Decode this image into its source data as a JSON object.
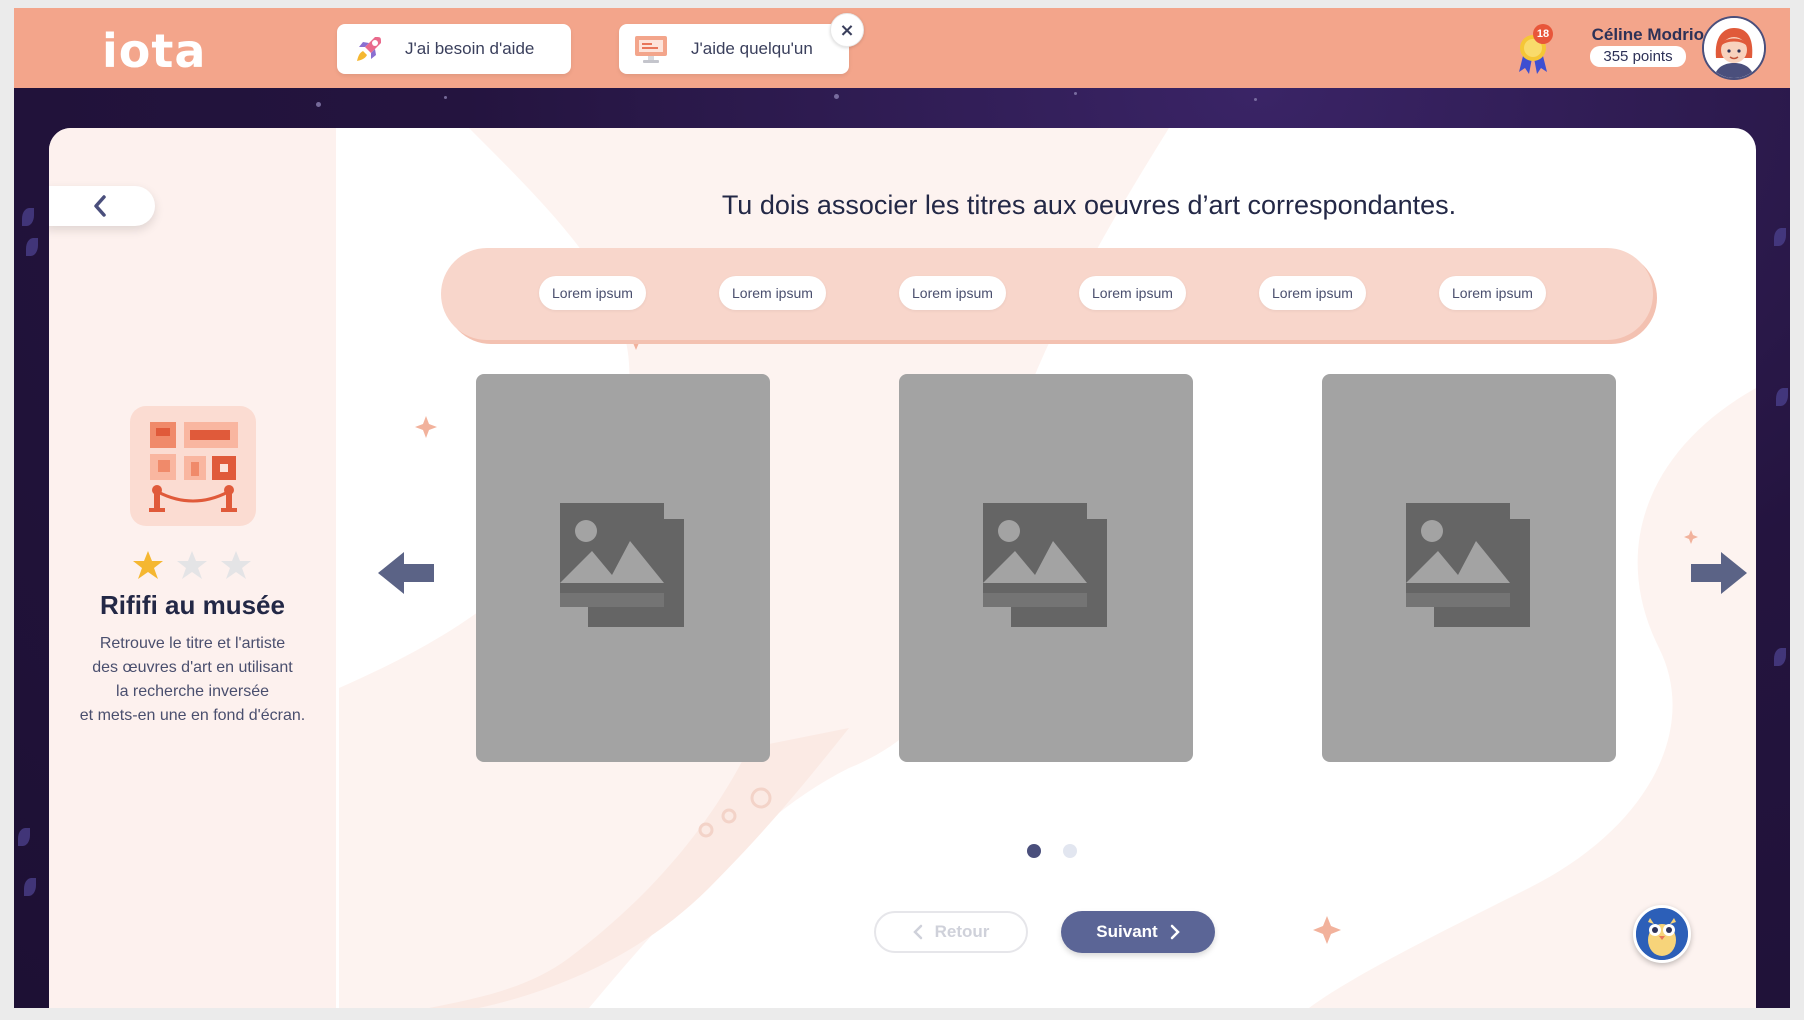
{
  "header": {
    "logo": "iota",
    "help_request_label": "J'ai besoin d'aide",
    "help_offer_label": "J'aide quelqu'un",
    "close_label": "×",
    "badge_count": "18",
    "user_name": "Céline Modrio",
    "user_points": "355 points"
  },
  "sidebar": {
    "activity_title": "Rififi au musée",
    "activity_description": "Retrouve le titre et l'artiste\ndes œuvres d'art en utilisant\nla recherche inversée\net mets-en une en fond d'écran.",
    "rating": {
      "filled": 1,
      "total": 3
    }
  },
  "main": {
    "instruction": "Tu dois associer les titres aux oeuvres d’art correspondantes.",
    "titles": [
      "Lorem ipsum",
      "Lorem ipsum",
      "Lorem ipsum",
      "Lorem ipsum",
      "Lorem ipsum",
      "Lorem ipsum"
    ],
    "artworks_count": 3,
    "pagination": {
      "current": 1,
      "total": 2
    },
    "back_label": "Retour",
    "next_label": "Suivant"
  },
  "colors": {
    "header_bg": "#f3a58b",
    "accent": "#5b6596",
    "title_bar": "#f8d6cb",
    "placeholder": "#a3a3a3",
    "star_active": "#f5b731",
    "star_inactive": "#e2e2e2"
  },
  "icons": {
    "help_request": "rocket-icon",
    "help_offer": "monitor-icon",
    "back": "chevron-left-icon",
    "prev": "arrow-left-icon",
    "next": "arrow-right-icon",
    "image_placeholder": "image-placeholder-icon",
    "badge": "medal-icon",
    "mascot": "owl-mascot-icon"
  }
}
